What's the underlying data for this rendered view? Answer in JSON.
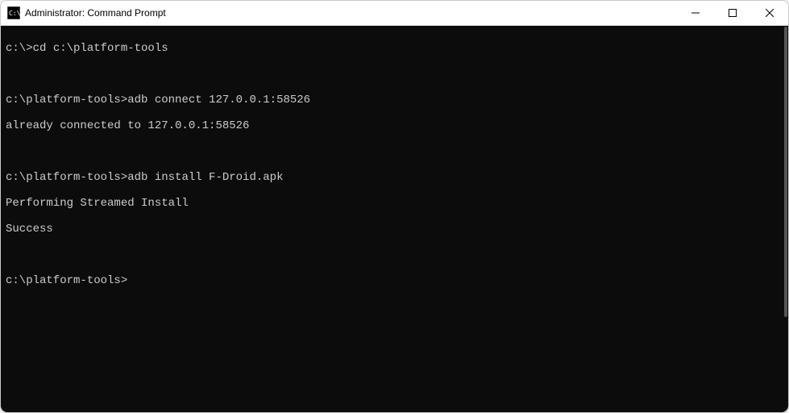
{
  "window": {
    "title": "Administrator: Command Prompt"
  },
  "terminal": {
    "lines": [
      {
        "prompt": "c:\\>",
        "command": "cd c:\\platform-tools"
      },
      {
        "prompt": "",
        "command": ""
      },
      {
        "prompt": "c:\\platform-tools>",
        "command": "adb connect 127.0.0.1:58526"
      },
      {
        "prompt": "",
        "output": "already connected to 127.0.0.1:58526"
      },
      {
        "prompt": "",
        "command": ""
      },
      {
        "prompt": "c:\\platform-tools>",
        "command": "adb install F-Droid.apk"
      },
      {
        "prompt": "",
        "output": "Performing Streamed Install"
      },
      {
        "prompt": "",
        "output": "Success"
      },
      {
        "prompt": "",
        "command": ""
      },
      {
        "prompt": "c:\\platform-tools>",
        "command": ""
      }
    ]
  }
}
